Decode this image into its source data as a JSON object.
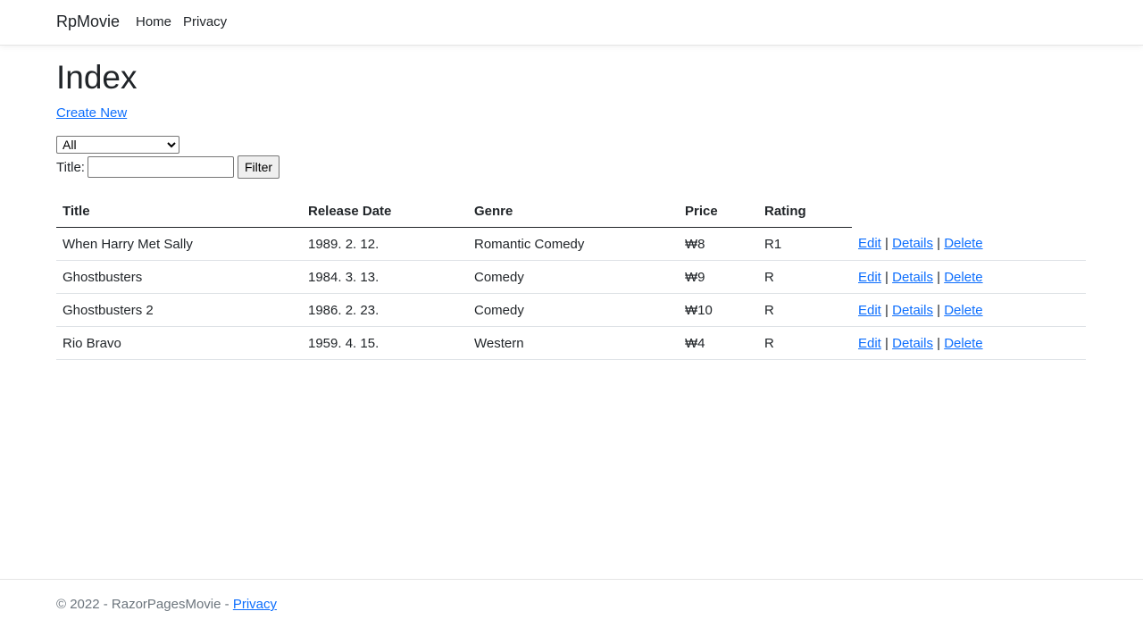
{
  "navbar": {
    "brand": "RpMovie",
    "links": [
      {
        "label": "Home"
      },
      {
        "label": "Privacy"
      }
    ]
  },
  "main": {
    "title": "Index",
    "create_new": "Create New",
    "genre_select": {
      "selected": "All"
    },
    "title_filter": {
      "label": "Title:",
      "value": ""
    },
    "filter_button": "Filter"
  },
  "table": {
    "headers": [
      "Title",
      "Release Date",
      "Genre",
      "Price",
      "Rating"
    ],
    "rows": [
      {
        "title": "When Harry Met Sally",
        "release_date": "1989. 2. 12.",
        "genre": "Romantic Comedy",
        "price": "₩8",
        "rating": "R1"
      },
      {
        "title": "Ghostbusters",
        "release_date": "1984. 3. 13.",
        "genre": "Comedy",
        "price": "₩9",
        "rating": "R"
      },
      {
        "title": "Ghostbusters 2",
        "release_date": "1986. 2. 23.",
        "genre": "Comedy",
        "price": "₩10",
        "rating": "R"
      },
      {
        "title": "Rio Bravo",
        "release_date": "1959. 4. 15.",
        "genre": "Western",
        "price": "₩4",
        "rating": "R"
      }
    ],
    "actions": {
      "edit": "Edit",
      "details": "Details",
      "delete": "Delete",
      "separator": "|"
    }
  },
  "footer": {
    "text": "© 2022 - RazorPagesMovie - ",
    "privacy": "Privacy"
  },
  "colors": {
    "link": "#0d6efd",
    "text": "#212529",
    "muted": "#6c757d"
  }
}
